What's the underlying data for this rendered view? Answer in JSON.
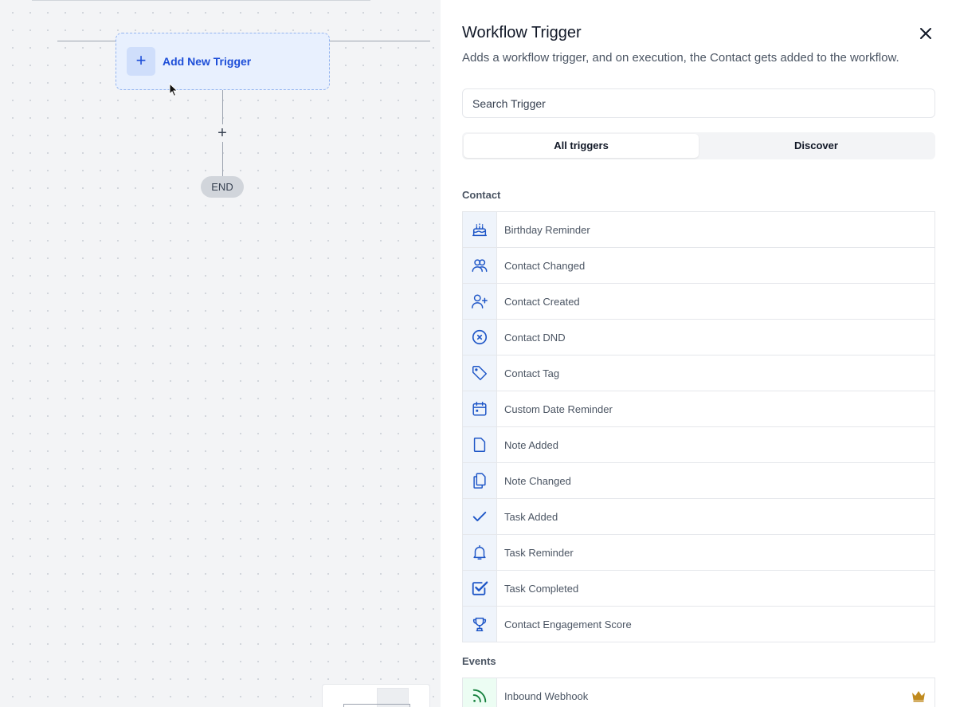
{
  "canvas": {
    "trigger_card_label": "Add New Trigger",
    "add_step_symbol": "+",
    "end_label": "END"
  },
  "panel": {
    "title": "Workflow Trigger",
    "subtitle": "Adds a workflow trigger, and on execution, the Contact gets added to the workflow.",
    "search_placeholder": "Search Trigger",
    "tabs": [
      {
        "label": "All triggers",
        "active": true
      },
      {
        "label": "Discover",
        "active": false
      }
    ],
    "sections": [
      {
        "title": "Contact",
        "items": [
          {
            "label": "Birthday Reminder",
            "icon": "cake-icon"
          },
          {
            "label": "Contact Changed",
            "icon": "users-icon"
          },
          {
            "label": "Contact Created",
            "icon": "user-plus-icon"
          },
          {
            "label": "Contact DND",
            "icon": "x-circle-icon"
          },
          {
            "label": "Contact Tag",
            "icon": "tag-icon"
          },
          {
            "label": "Custom Date Reminder",
            "icon": "calendar-icon"
          },
          {
            "label": "Note Added",
            "icon": "file-icon"
          },
          {
            "label": "Note Changed",
            "icon": "files-icon"
          },
          {
            "label": "Task Added",
            "icon": "check-icon"
          },
          {
            "label": "Task Reminder",
            "icon": "bell-icon"
          },
          {
            "label": "Task Completed",
            "icon": "checkbox-icon"
          },
          {
            "label": "Contact Engagement Score",
            "icon": "trophy-icon"
          }
        ]
      },
      {
        "title": "Events",
        "items": [
          {
            "label": "Inbound Webhook",
            "icon": "rss-icon",
            "premium_icon": "crown-icon"
          }
        ]
      }
    ]
  },
  "colors": {
    "accent": "#1d4ed8",
    "icon_blue": "#1e56c7",
    "icon_green": "#15803d",
    "crown": "#c08a1e"
  }
}
